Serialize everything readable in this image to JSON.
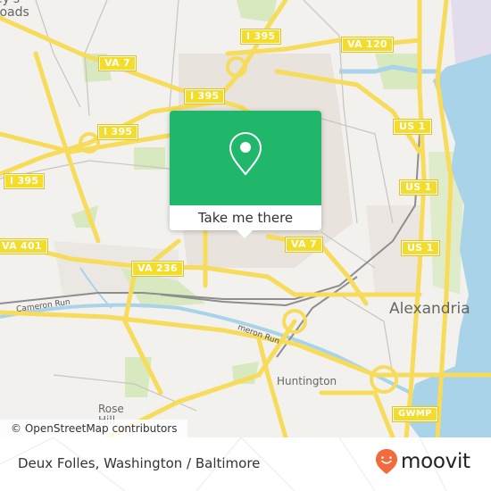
{
  "map": {
    "shields": [
      {
        "label": "I 395",
        "name": "shield-i395-north"
      },
      {
        "label": "VA 120",
        "name": "shield-va120"
      },
      {
        "label": "VA 7",
        "name": "shield-va7-west"
      },
      {
        "label": "I 395",
        "name": "shield-i395-mid"
      },
      {
        "label": "I 395",
        "name": "shield-i395-west"
      },
      {
        "label": "US 1",
        "name": "shield-us1-north"
      },
      {
        "label": "I 395",
        "name": "shield-i395-southwest"
      },
      {
        "label": "US 1",
        "name": "shield-us1-mid"
      },
      {
        "label": "US 1",
        "name": "shield-us1-south"
      },
      {
        "label": "VA 7",
        "name": "shield-va7-east"
      },
      {
        "label": "VA 401",
        "name": "shield-va401"
      },
      {
        "label": "VA 236",
        "name": "shield-va236"
      },
      {
        "label": "GWMP",
        "name": "shield-gwmp"
      }
    ],
    "places": {
      "crossroads_top": "ey's",
      "crossroads_bottom": "roads",
      "alexandria": "Alexandria",
      "huntington": "Huntington",
      "rose_top": "Rose",
      "rose_bottom": "Hill",
      "cameron_run": "Cameron Run",
      "cameron_run_2": "meron Run"
    },
    "attribution": "© OpenStreetMap contributors",
    "colors": {
      "land": "#f2f1ee",
      "road": "#f6dc5a",
      "water": "#a9d3e8",
      "park": "#d8e9bf",
      "popup_green": "#20b76b"
    }
  },
  "popup": {
    "button_label": "Take me there",
    "icon": "map-pin-icon"
  },
  "footer": {
    "title": "Deux Folles, Washington / Baltimore",
    "brand": "moovit",
    "brand_color": "#f26a3d"
  }
}
